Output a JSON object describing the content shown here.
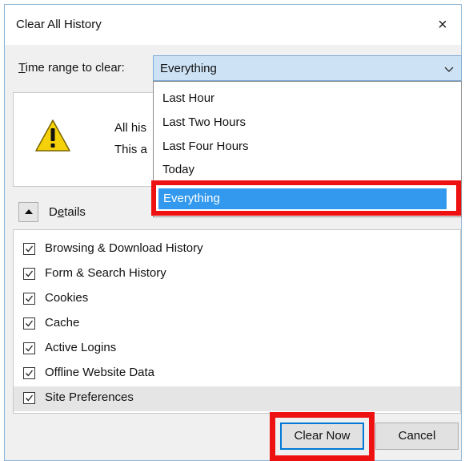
{
  "dialog": {
    "title": "Clear All History",
    "close_glyph": "×"
  },
  "time_range": {
    "label_accel": "T",
    "label_rest": "ime range to clear:",
    "selected": "Everything",
    "options": [
      "Last Hour",
      "Last Two Hours",
      "Last Four Hours",
      "Today",
      "Everything"
    ]
  },
  "warning": {
    "icon": "warning-icon",
    "line1": "All his",
    "line2": "This a"
  },
  "details": {
    "label_pre": "D",
    "label_accel": "e",
    "label_rest": "tails",
    "toggle_icon": "chevron-up-icon",
    "items": [
      {
        "label": "Browsing & Download History",
        "checked": true
      },
      {
        "label": "Form & Search History",
        "checked": true
      },
      {
        "label": "Cookies",
        "checked": true
      },
      {
        "label": "Cache",
        "checked": true
      },
      {
        "label": "Active Logins",
        "checked": true
      },
      {
        "label": "Offline Website Data",
        "checked": true
      },
      {
        "label": "Site Preferences",
        "checked": true
      }
    ]
  },
  "buttons": {
    "clear_now": "Clear Now",
    "cancel": "Cancel"
  },
  "colors": {
    "highlight": "#ee1111",
    "selection": "#3399ee",
    "focus": "#0078d7",
    "warning": "#f5d10a"
  }
}
